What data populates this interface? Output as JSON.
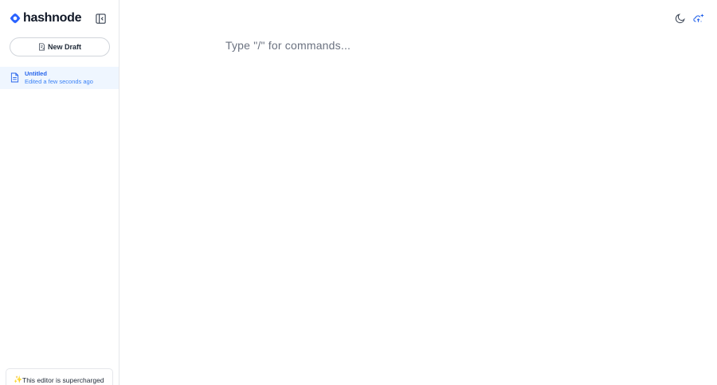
{
  "brand": {
    "name": "hashnode",
    "accent": "#2962ff"
  },
  "sidebar": {
    "collapse_icon": "sidebar-collapse-icon",
    "new_draft": {
      "label": "New Draft",
      "icon": "draft-icon"
    },
    "drafts": [
      {
        "title": "Untitled",
        "meta": "Edited a few seconds ago",
        "icon": "document-icon"
      }
    ],
    "promo": {
      "sparkle": "✨",
      "text": "This editor is supercharged"
    }
  },
  "editor": {
    "placeholder": "Type \"/\" for commands..."
  },
  "topbar": {
    "theme_icon": "moon-icon",
    "publish_icon": "cloud-upload-icon"
  },
  "colors": {
    "accent": "#2563eb",
    "selected_bg": "#eff6ff",
    "border": "#e5e7eb"
  }
}
